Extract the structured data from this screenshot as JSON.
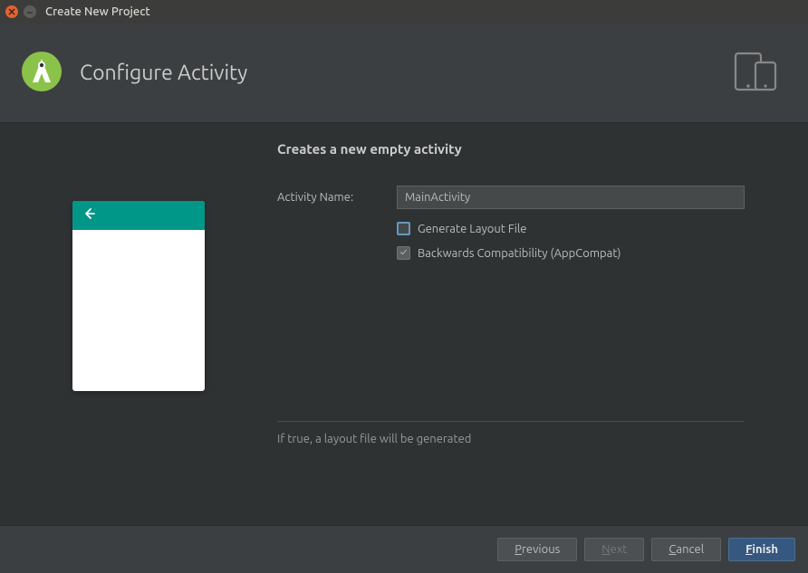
{
  "window": {
    "title": "Create New Project"
  },
  "header": {
    "title": "Configure Activity"
  },
  "content": {
    "section_title": "Creates a new empty activity",
    "activity_name_label": "Activity Name:",
    "activity_name_value": "MainActivity",
    "generate_layout_label": "Generate Layout File",
    "generate_layout_checked": false,
    "backwards_compat_label": "Backwards Compatibility (AppCompat)",
    "backwards_compat_checked": true,
    "hint": "If true, a layout file will be generated"
  },
  "footer": {
    "previous": "Previous",
    "next": "Next",
    "cancel": "Cancel",
    "finish": "Finish"
  },
  "colors": {
    "teal": "#009688",
    "android_green": "#8bc34a"
  }
}
